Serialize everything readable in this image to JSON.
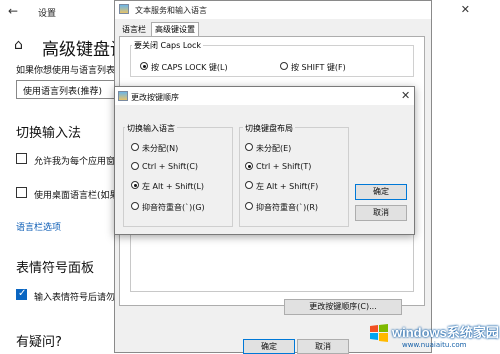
{
  "settings": {
    "back_icon": "back-arrow-icon",
    "title": "设置",
    "window_controls": "—  ☐  ✕",
    "home_icon": "home-icon",
    "heading": "高级键盘设",
    "description": "如果你想使用与语言列表中",
    "dropdown_value": "使用语言列表(推荐)",
    "switch_section": "切换输入法",
    "check1_label": "允许我为每个应用窗",
    "check2_label": "使用桌面语言栏(如果",
    "language_bar_link": "语言栏选项",
    "emoji_section": "表情符号面板",
    "check3_label": "输入表情符号后请勿",
    "question_section": "有疑问?"
  },
  "text_services": {
    "icon": "keyboard-settings-icon",
    "title": "文本服务和输入语言",
    "tabs": [
      "语言栏",
      "高级键设置"
    ],
    "caps_group_title": "要关闭 Caps Lock",
    "caps_option1": "按 CAPS LOCK 键(L)",
    "caps_option2": "按 SHIFT 键(F)",
    "change_sequence_button": "更改按键顺序(C)...",
    "ok_button": "确定",
    "cancel_button": "取消"
  },
  "change_key": {
    "icon": "keyboard-settings-icon",
    "title": "更改按键顺序",
    "close_icon": "close-icon",
    "left_group_title": "切换输入语言",
    "left_options": [
      "未分配(N)",
      "Ctrl + Shift(C)",
      "左 Alt + Shift(L)",
      "抑音符重音(`)(G)"
    ],
    "left_selected": 2,
    "right_group_title": "切换键盘布局",
    "right_options": [
      "未分配(E)",
      "Ctrl + Shift(T)",
      "左 Alt + Shift(F)",
      "抑音符重音(`)(R)"
    ],
    "right_selected": 1,
    "ok_button": "确定",
    "cancel_button": "取消"
  },
  "watermark": {
    "text": "windows系统家园",
    "url": "www.nuaiaitu.com"
  }
}
